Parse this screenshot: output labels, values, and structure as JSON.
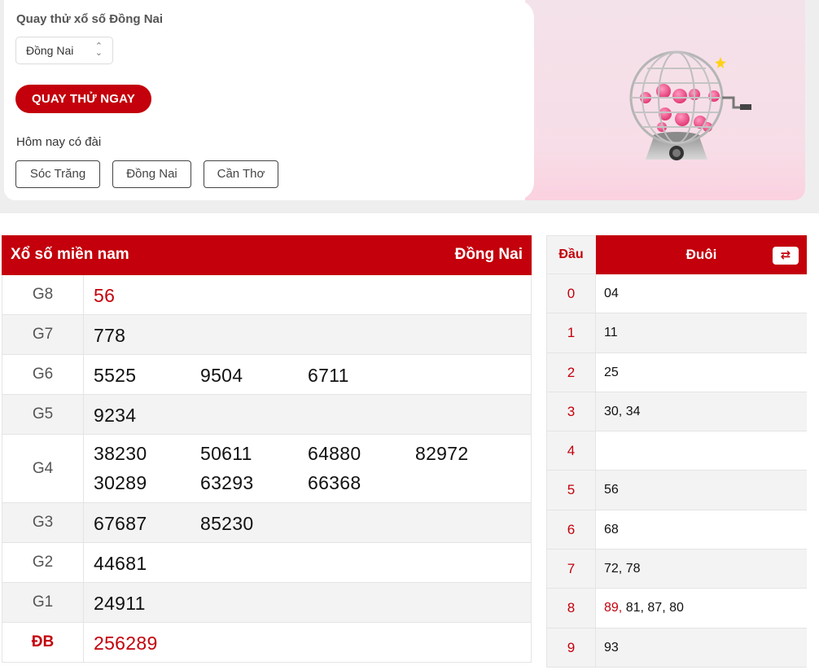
{
  "quay_thu": {
    "title": "Quay thử xổ số Đồng Nai",
    "province_select": {
      "value": "Đồng Nai"
    },
    "spin_button": "QUAY THỬ NGAY",
    "today_label": "Hôm nay có đài",
    "today_provinces": [
      "Sóc Trăng",
      "Đồng Nai",
      "Cần Thơ"
    ]
  },
  "results": {
    "header_left": "Xổ số miền nam",
    "header_right": "Đồng Nai",
    "prizes": [
      {
        "label": "G8",
        "numbers": [
          "56"
        ]
      },
      {
        "label": "G7",
        "numbers": [
          "778"
        ]
      },
      {
        "label": "G6",
        "numbers": [
          "5525",
          "9504",
          "6711"
        ]
      },
      {
        "label": "G5",
        "numbers": [
          "9234"
        ]
      },
      {
        "label": "G4",
        "numbers": [
          "38230",
          "50611",
          "64880",
          "82972",
          "30289",
          "63293",
          "66368"
        ]
      },
      {
        "label": "G3",
        "numbers": [
          "67687",
          "85230"
        ]
      },
      {
        "label": "G2",
        "numbers": [
          "44681"
        ]
      },
      {
        "label": "G1",
        "numbers": [
          "24911"
        ]
      },
      {
        "label": "ĐB",
        "numbers": [
          "256289"
        ]
      }
    ]
  },
  "dau_duoi": {
    "head_dau": "Đầu",
    "head_duoi": "Đuôi",
    "swap_icon": "swap-arrows-icon",
    "rows": [
      {
        "dau": "0",
        "duoi": "04",
        "highlight": ""
      },
      {
        "dau": "1",
        "duoi": "11",
        "highlight": ""
      },
      {
        "dau": "2",
        "duoi": "25",
        "highlight": ""
      },
      {
        "dau": "3",
        "duoi": "30, 34",
        "highlight": ""
      },
      {
        "dau": "4",
        "duoi": "",
        "highlight": ""
      },
      {
        "dau": "5",
        "duoi": "56",
        "highlight": ""
      },
      {
        "dau": "6",
        "duoi": "68",
        "highlight": ""
      },
      {
        "dau": "7",
        "duoi": "72, 78",
        "highlight": ""
      },
      {
        "dau": "8",
        "duoi": "81, 87, 80",
        "highlight": "89,"
      },
      {
        "dau": "9",
        "duoi": "93",
        "highlight": ""
      }
    ]
  },
  "colors": {
    "accent": "#c3000b",
    "row_alt": "#f3f3f3",
    "pink_panel": "#f7dde7"
  }
}
